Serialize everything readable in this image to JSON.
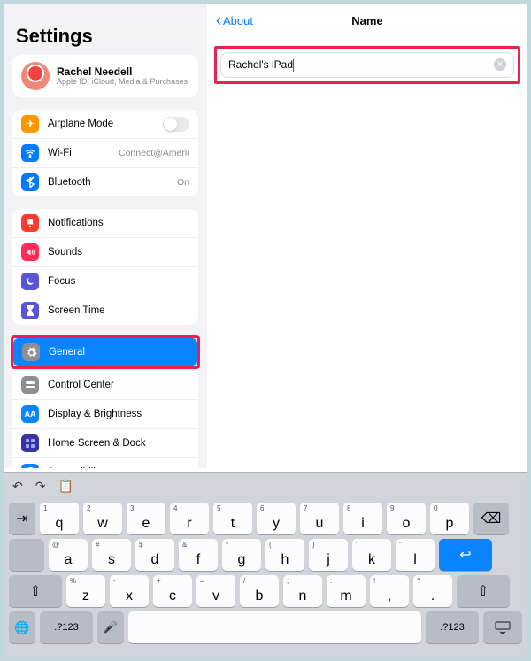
{
  "sidebar": {
    "title": "Settings",
    "profile": {
      "name": "Rachel Needell",
      "subtitle": "Apple ID, iCloud, Media & Purchases"
    },
    "group1": [
      {
        "label": "Airplane Mode",
        "accessory_type": "toggle",
        "icon_bg": "#ff9500",
        "icon": "airplane"
      },
      {
        "label": "Wi-Fi",
        "accessory": "Connect@AmericInn",
        "icon_bg": "#007aff",
        "icon": "wifi"
      },
      {
        "label": "Bluetooth",
        "accessory": "On",
        "icon_bg": "#007aff",
        "icon": "bluetooth"
      }
    ],
    "group2": [
      {
        "label": "Notifications",
        "icon_bg": "#ff3b30",
        "icon": "bell"
      },
      {
        "label": "Sounds",
        "icon_bg": "#ff2d55",
        "icon": "speaker"
      },
      {
        "label": "Focus",
        "icon_bg": "#5856d6",
        "icon": "moon"
      },
      {
        "label": "Screen Time",
        "icon_bg": "#5856d6",
        "icon": "hourglass"
      }
    ],
    "group3": [
      {
        "label": "General",
        "icon_bg": "#8e8e93",
        "icon": "gear",
        "selected": true
      },
      {
        "label": "Control Center",
        "icon_bg": "#8e8e93",
        "icon": "switches"
      },
      {
        "label": "Display & Brightness",
        "icon_bg": "#0a84ff",
        "icon": "AA"
      },
      {
        "label": "Home Screen & Dock",
        "icon_bg": "#3634a3",
        "icon": "grid"
      },
      {
        "label": "Accessibility",
        "icon_bg": "#0a84ff",
        "icon": "access"
      }
    ]
  },
  "detail": {
    "back_label": "About",
    "title": "Name",
    "name_value": "Rachel's iPad"
  },
  "keyboard": {
    "row1": [
      {
        "k": "q",
        "n": "1"
      },
      {
        "k": "w",
        "n": "2"
      },
      {
        "k": "e",
        "n": "3"
      },
      {
        "k": "r",
        "n": "4"
      },
      {
        "k": "t",
        "n": "5"
      },
      {
        "k": "y",
        "n": "6"
      },
      {
        "k": "u",
        "n": "7"
      },
      {
        "k": "i",
        "n": "8"
      },
      {
        "k": "o",
        "n": "9"
      },
      {
        "k": "p",
        "n": "0"
      }
    ],
    "row2": [
      {
        "k": "a",
        "n": "@"
      },
      {
        "k": "s",
        "n": "#"
      },
      {
        "k": "d",
        "n": "$"
      },
      {
        "k": "f",
        "n": "&"
      },
      {
        "k": "g",
        "n": "*"
      },
      {
        "k": "h",
        "n": "("
      },
      {
        "k": "j",
        "n": ")"
      },
      {
        "k": "k",
        "n": "'"
      },
      {
        "k": "l",
        "n": "\""
      }
    ],
    "row3": [
      {
        "k": "z",
        "n": "%"
      },
      {
        "k": "x",
        "n": "-"
      },
      {
        "k": "c",
        "n": "+"
      },
      {
        "k": "v",
        "n": "="
      },
      {
        "k": "b",
        "n": "/"
      },
      {
        "k": "n",
        "n": ";"
      },
      {
        "k": "m",
        "n": ":"
      },
      {
        "k": ",",
        "n": "!"
      },
      {
        "k": ".",
        "n": "?"
      }
    ],
    "num_key": ".?123"
  }
}
